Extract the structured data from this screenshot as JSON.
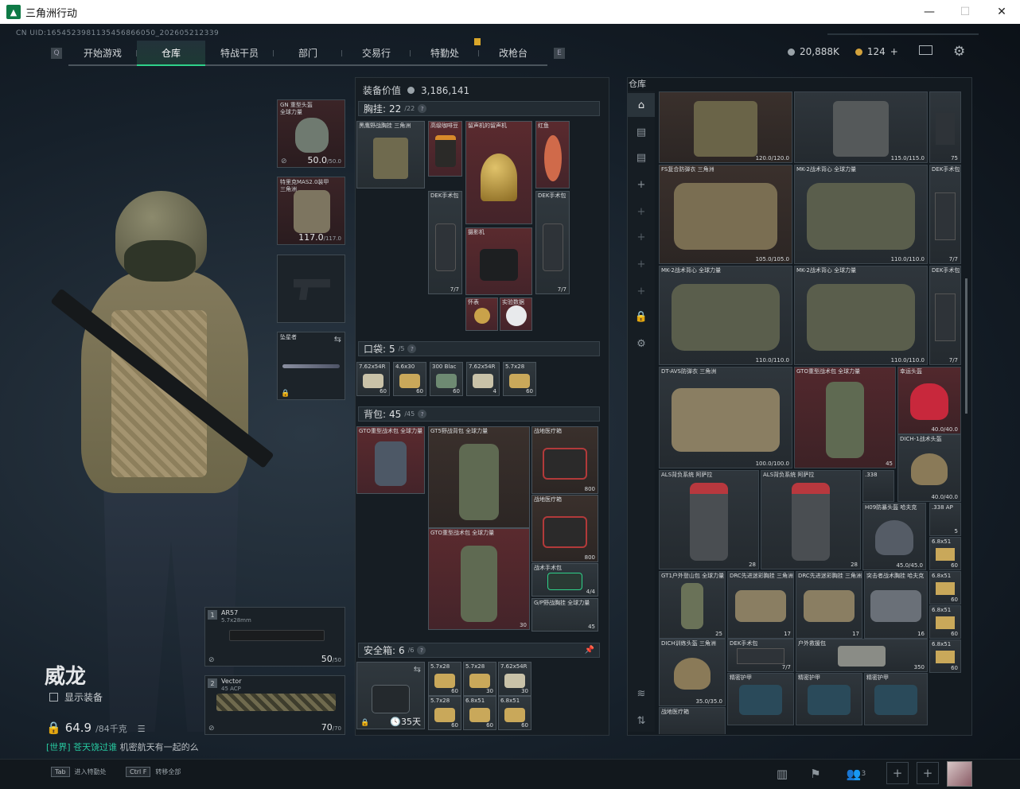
{
  "window": {
    "title": "三角洲行动",
    "min": "—",
    "max": "☐",
    "close": "✕"
  },
  "uid": "CN UID:1654523981135456866050_202605212339",
  "nav": {
    "left_key": "Q",
    "right_key": "E",
    "tabs": [
      "开始游戏",
      "仓库",
      "特战干员",
      "部门",
      "交易行",
      "特勤处",
      "改枪台"
    ],
    "active": 1
  },
  "currency": {
    "silver": "20,888K",
    "gold": "124",
    "add": "+"
  },
  "operator": {
    "name": "威龙",
    "show_equipment": "显示装备",
    "weight": "64.9",
    "weight_cap": "/84千克",
    "chat_channel": "[世界]",
    "chat_user": "苍天饶过谁",
    "chat_msg": "机密航天有一起的么"
  },
  "equip_slots": [
    {
      "name": "GN 重型头盔",
      "sub": "全球力量",
      "dur": "50.0",
      "max": "/50.0"
    },
    {
      "name": "特里克MAS2.0装甲",
      "sub": "三角洲",
      "dur": "117.0",
      "max": "/117.0"
    },
    {
      "name": "",
      "sub": "",
      "dur": "",
      "max": ""
    },
    {
      "name": "坠星者",
      "sub": "",
      "dur": "",
      "max": ""
    }
  ],
  "weapons": [
    {
      "slot": "1",
      "name": "AR57",
      "caliber": "5.7x28mm",
      "dur": "50",
      "max": "/50"
    },
    {
      "slot": "2",
      "name": "Vector",
      "caliber": "45 ACP",
      "dur": "70",
      "max": "/70"
    }
  ],
  "loadout": {
    "value_label": "装备价值",
    "value": "3,186,141",
    "chest": {
      "label": "胸挂:",
      "count": "22",
      "cap": "/22"
    },
    "pocket": {
      "label": "口袋:",
      "count": "5",
      "cap": "/5"
    },
    "backpack": {
      "label": "背包:",
      "count": "45",
      "cap": "/45"
    },
    "safe": {
      "label": "安全箱:",
      "count": "6",
      "cap": "/6",
      "days": "35天"
    },
    "chest_items": [
      {
        "name": "黑鹰野战胸挂 三角洲",
        "q": ""
      },
      {
        "name": "高级咖啡豆",
        "q": ""
      },
      {
        "name": "留声机的留声机",
        "q": ""
      },
      {
        "name": "红鱼",
        "q": ""
      },
      {
        "name": "DEK手术包",
        "q": "7/7"
      },
      {
        "name": "摄影机",
        "q": ""
      },
      {
        "name": "DEK手术包",
        "q": "7/7"
      },
      {
        "name": "怀表",
        "q": ""
      },
      {
        "name": "实验数据",
        "q": ""
      }
    ],
    "pocket_items": [
      {
        "name": "7.62x54R",
        "q": "60"
      },
      {
        "name": "4.6x30",
        "q": "60"
      },
      {
        "name": "300 Blac",
        "q": "60"
      },
      {
        "name": "7.62x54R",
        "q": "4"
      },
      {
        "name": "5.7x28",
        "q": "60"
      }
    ],
    "backpack_items": [
      {
        "name": "GTO重型战术包 全球力量",
        "q": ""
      },
      {
        "name": "GT5野战背包 全球力量",
        "q": ""
      },
      {
        "name": "战地医疗箱",
        "q": "800"
      },
      {
        "name": "战地医疗箱",
        "q": "800"
      },
      {
        "name": "GTO重型战术包 全球力量",
        "q": "30"
      },
      {
        "name": "战术手术包",
        "q": "4/4"
      },
      {
        "name": "G/P野战胸挂 全球力量",
        "q": "45"
      }
    ],
    "safe_items": [
      {
        "name": "5.7x28",
        "q": "60"
      },
      {
        "name": "5.7x28",
        "q": "30"
      },
      {
        "name": "7.62x54R",
        "q": "30"
      },
      {
        "name": "5.7x28",
        "q": "60"
      },
      {
        "name": "6.8x51",
        "q": "60"
      },
      {
        "name": "6.8x51",
        "q": "60"
      }
    ]
  },
  "stash": {
    "title": "仓库",
    "items": [
      {
        "name": "",
        "q": "120.0/120.0"
      },
      {
        "name": "",
        "q": "115.0/115.0"
      },
      {
        "name": "",
        "q": "75"
      },
      {
        "name": "FS复合防弹衣 三角洲",
        "q": "105.0/105.0"
      },
      {
        "name": "MK-2战术背心 全球力量",
        "q": "110.0/110.0"
      },
      {
        "name": "DEK手术包",
        "q": "7/7"
      },
      {
        "name": "MK-2战术背心 全球力量",
        "q": "110.0/110.0"
      },
      {
        "name": "MK-2战术背心 全球力量",
        "q": "110.0/110.0"
      },
      {
        "name": "DEK手术包",
        "q": "7/7"
      },
      {
        "name": "DT-AVS防弹衣 三角洲",
        "q": "100.0/100.0"
      },
      {
        "name": "GTO重型战术包 全球力量",
        "q": "45"
      },
      {
        "name": "幸运头盔",
        "q": "40.0/40.0"
      },
      {
        "name": "DICH-1战术头盔",
        "q": "40.0/40.0"
      },
      {
        "name": "ALS背负系统 阿萨拉",
        "q": "28"
      },
      {
        "name": "ALS背负系统 阿萨拉",
        "q": "28"
      },
      {
        "name": ".338",
        "q": ""
      },
      {
        "name": "H09防暴头盔 哈夫克",
        "q": "45.0/45.0"
      },
      {
        "name": ".338 AP",
        "q": "5"
      },
      {
        "name": "6.8x51",
        "q": "60"
      },
      {
        "name": "GT1户外登山包 全球力量",
        "q": "25"
      },
      {
        "name": "DRC先进迷彩胸挂 三角洲",
        "q": "17"
      },
      {
        "name": "DRC先进迷彩胸挂 三角洲",
        "q": "17"
      },
      {
        "name": "突击者战术胸挂 哈夫克",
        "q": "16"
      },
      {
        "name": "6.8x51",
        "q": "60"
      },
      {
        "name": "DICH训练头盔 三角洲",
        "q": "35.0/35.0"
      },
      {
        "name": "DEK手术包",
        "q": "7/7"
      },
      {
        "name": "户外救援包",
        "q": "350"
      },
      {
        "name": "6.8x51",
        "q": "60"
      },
      {
        "name": "精密护甲",
        "q": ""
      },
      {
        "name": "精密护甲",
        "q": ""
      },
      {
        "name": "精密护甲",
        "q": ""
      },
      {
        "name": "6.8x51",
        "q": "60"
      },
      {
        "name": "战地医疗箱",
        "q": ""
      }
    ]
  },
  "bottom": {
    "hint1_key": "Tab",
    "hint1": "进入特勤处",
    "hint2_key": "Ctrl F",
    "hint2": "转移全部",
    "squad_count": "3"
  }
}
